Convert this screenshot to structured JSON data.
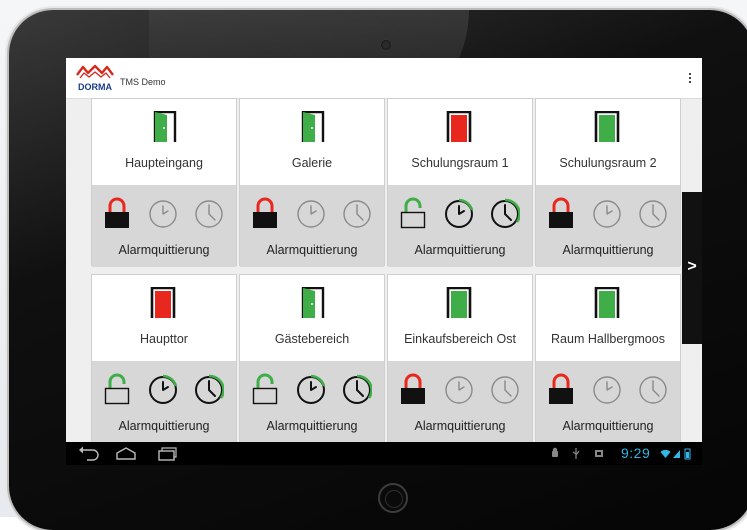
{
  "app": {
    "logo_text": "DORMA",
    "title": "TMS Demo"
  },
  "colors": {
    "green": "#3fae49",
    "red": "#e8281e",
    "black": "#111111",
    "grey_icon": "#8a8a8a",
    "clock_hl": "#3fae49",
    "time": "#33b5e5"
  },
  "doors": [
    {
      "name": "Haupteingang",
      "door": {
        "color": "green",
        "state": "open"
      },
      "lock": {
        "state": "locked",
        "shackle": "red",
        "body": "black"
      },
      "clocks": [
        "inactive",
        "inactive"
      ],
      "ack_label": "Alarmquittierung"
    },
    {
      "name": "Galerie",
      "door": {
        "color": "green",
        "state": "open"
      },
      "lock": {
        "state": "locked",
        "shackle": "red",
        "body": "black"
      },
      "clocks": [
        "inactive",
        "inactive"
      ],
      "ack_label": "Alarmquittierung"
    },
    {
      "name": "Schulungsraum 1",
      "door": {
        "color": "red",
        "state": "closed"
      },
      "lock": {
        "state": "unlocked",
        "shackle": "green",
        "body": "outline"
      },
      "clocks": [
        "active",
        "active"
      ],
      "ack_label": "Alarmquittierung"
    },
    {
      "name": "Schulungsraum 2",
      "door": {
        "color": "green",
        "state": "closed"
      },
      "lock": {
        "state": "locked",
        "shackle": "red",
        "body": "black"
      },
      "clocks": [
        "inactive",
        "inactive"
      ],
      "ack_label": "Alarmquittierung"
    },
    {
      "name": "Haupttor",
      "door": {
        "color": "red",
        "state": "closed"
      },
      "lock": {
        "state": "unlocked",
        "shackle": "green",
        "body": "outline"
      },
      "clocks": [
        "active",
        "active"
      ],
      "ack_label": "Alarmquittierung"
    },
    {
      "name": "Gästebereich",
      "door": {
        "color": "green",
        "state": "open"
      },
      "lock": {
        "state": "unlocked",
        "shackle": "green",
        "body": "outline"
      },
      "clocks": [
        "active",
        "active"
      ],
      "ack_label": "Alarmquittierung"
    },
    {
      "name": "Einkaufsbereich Ost",
      "door": {
        "color": "green",
        "state": "closed"
      },
      "lock": {
        "state": "locked",
        "shackle": "red",
        "body": "black"
      },
      "clocks": [
        "inactive",
        "inactive"
      ],
      "ack_label": "Alarmquittierung"
    },
    {
      "name": "Raum Hallbergmoos",
      "door": {
        "color": "green",
        "state": "closed"
      },
      "lock": {
        "state": "locked",
        "shackle": "red",
        "body": "black"
      },
      "clocks": [
        "inactive",
        "inactive"
      ],
      "ack_label": "Alarmquittierung"
    }
  ],
  "next_label": ">",
  "status": {
    "time": "9:29"
  },
  "navigation": {
    "icons": [
      "back-icon",
      "home-icon",
      "recent-apps-icon"
    ]
  }
}
